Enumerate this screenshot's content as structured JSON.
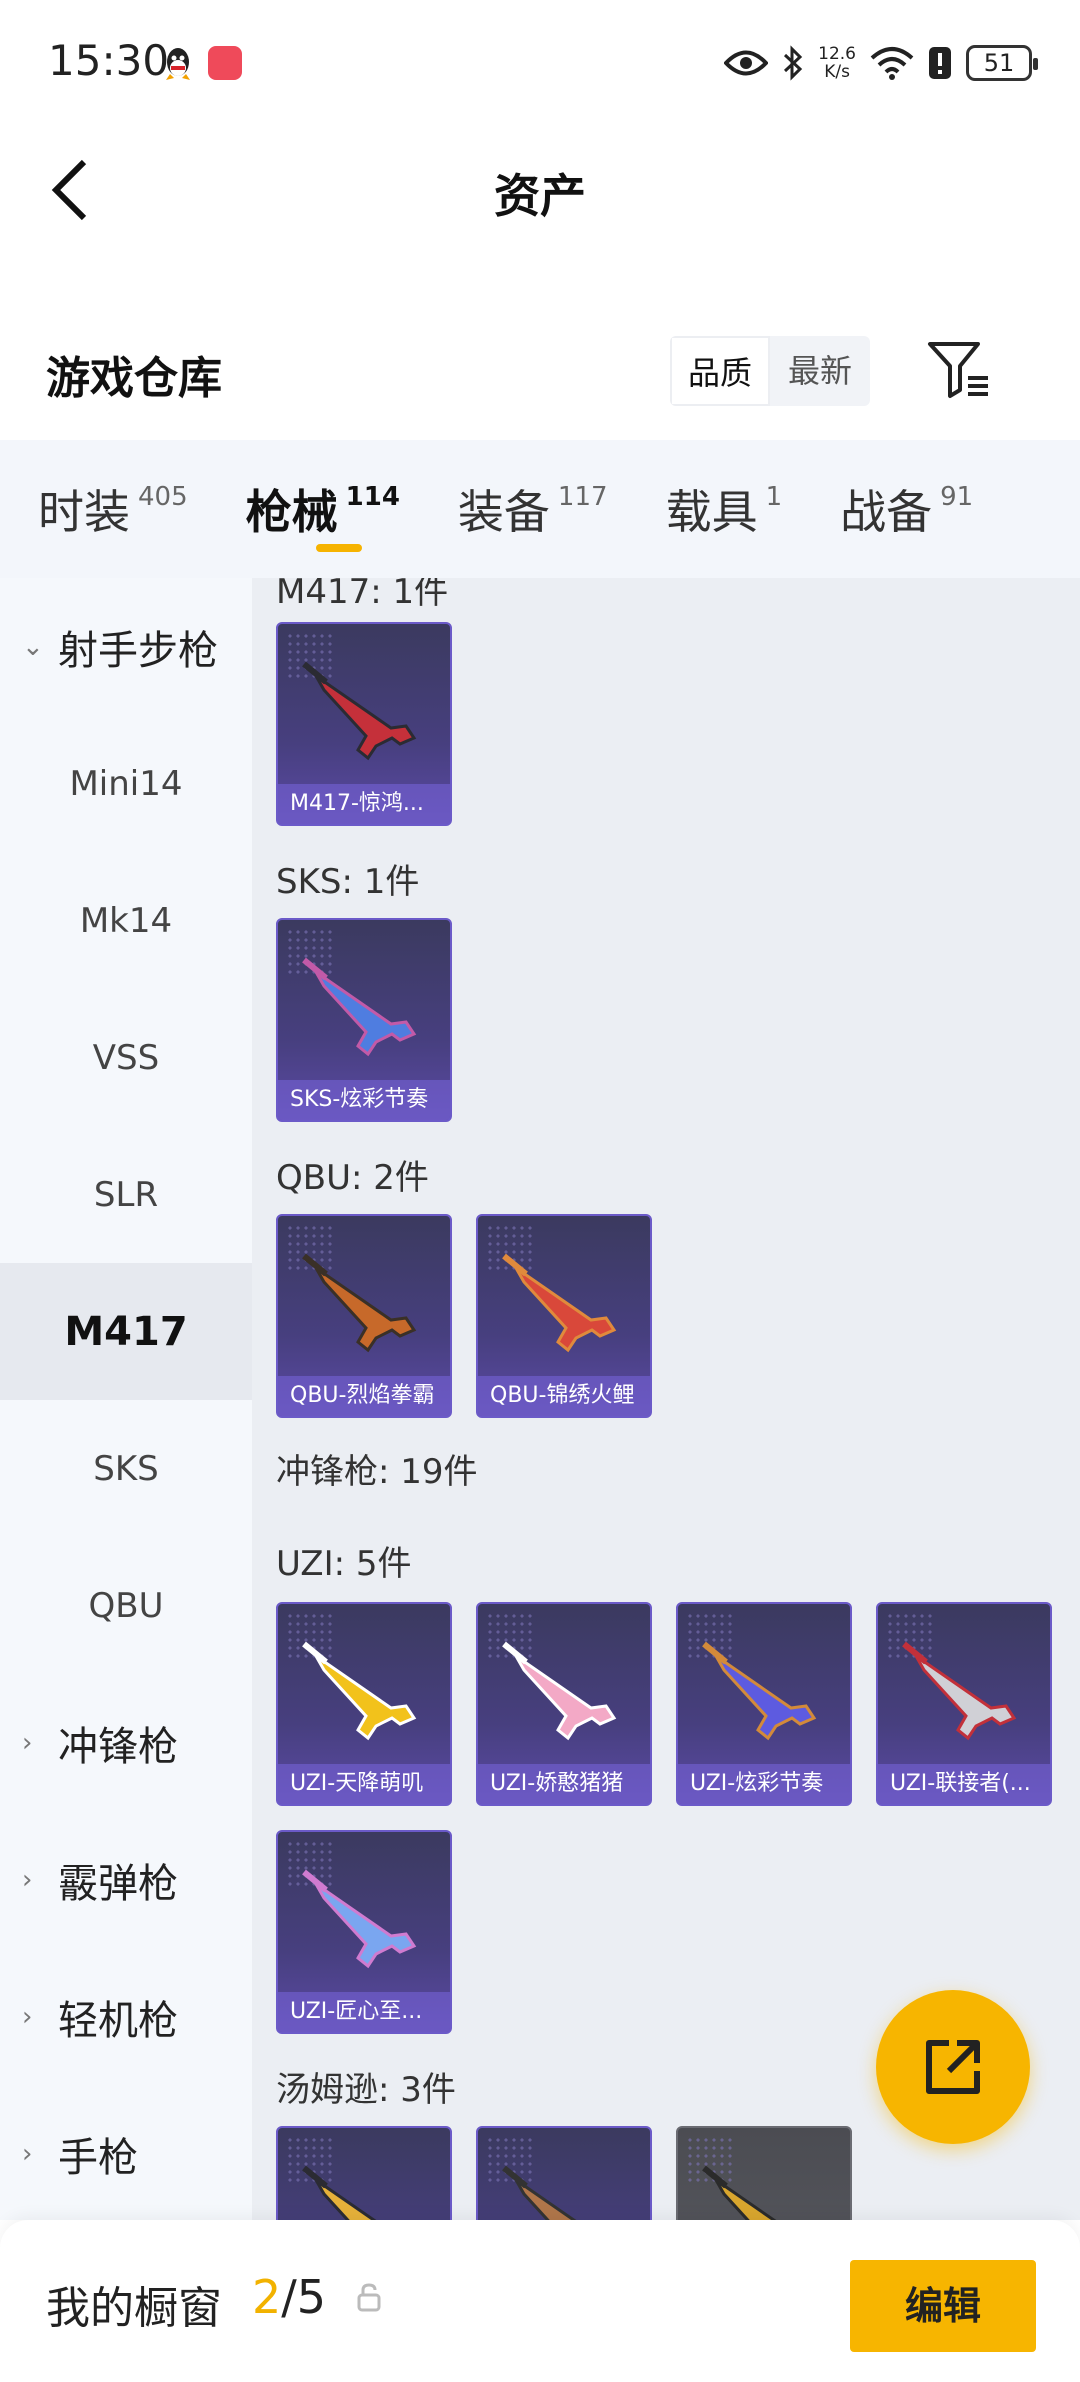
{
  "status_bar": {
    "time": "15:30",
    "net_speed_value": "12.6",
    "net_speed_unit": "K/s",
    "battery": "51",
    "icons": [
      "qq-icon",
      "app-notification-icon",
      "eye-icon",
      "bluetooth-icon",
      "wifi-icon",
      "alert-icon",
      "battery-icon"
    ]
  },
  "header": {
    "title": "资产",
    "back_icon": "chevron-left-icon"
  },
  "warehouse": {
    "title": "游戏仓库",
    "sort_options": [
      "品质",
      "最新"
    ],
    "sort_selected": "品质",
    "filter_icon": "filter-icon"
  },
  "tabs": [
    {
      "label": "时装",
      "count": "405"
    },
    {
      "label": "枪械",
      "count": "114",
      "active": true
    },
    {
      "label": "装备",
      "count": "117"
    },
    {
      "label": "载具",
      "count": "1"
    },
    {
      "label": "战备",
      "count": "91"
    }
  ],
  "sidebar": {
    "items": [
      {
        "label": "射手步枪",
        "type": "group",
        "expanded": true
      },
      {
        "label": "Mini14",
        "type": "sub"
      },
      {
        "label": "Mk14",
        "type": "sub"
      },
      {
        "label": "VSS",
        "type": "sub"
      },
      {
        "label": "SLR",
        "type": "sub"
      },
      {
        "label": "M417",
        "type": "sub",
        "active": true
      },
      {
        "label": "SKS",
        "type": "sub"
      },
      {
        "label": "QBU",
        "type": "sub"
      },
      {
        "label": "冲锋枪",
        "type": "group",
        "expanded": false
      },
      {
        "label": "霰弹枪",
        "type": "group",
        "expanded": false
      },
      {
        "label": "轻机枪",
        "type": "group",
        "expanded": false
      },
      {
        "label": "手枪",
        "type": "group",
        "expanded": false
      }
    ]
  },
  "content": {
    "partial_header": "M417: 1件",
    "groups": [
      {
        "heading": "SKS: 1件"
      },
      {
        "heading": "QBU: 2件"
      },
      {
        "heading": "冲锋枪: 19件"
      },
      {
        "heading": "UZI: 5件"
      },
      {
        "heading": "汤姆逊: 3件"
      }
    ],
    "cards": [
      {
        "name": "M417-惊鸿...",
        "colors": [
          "#c5303a",
          "#2b2b33"
        ]
      },
      {
        "name": "SKS-炫彩节奏",
        "colors": [
          "#4f7de0",
          "#c25aa8"
        ]
      },
      {
        "name": "QBU-烈焰拳霸",
        "colors": [
          "#c7692a",
          "#3a3027"
        ]
      },
      {
        "name": "QBU-锦绣火鲤",
        "colors": [
          "#d9483a",
          "#e08a3c"
        ]
      },
      {
        "name": "UZI-天降萌叽",
        "colors": [
          "#f2c21b",
          "#ffffff"
        ]
      },
      {
        "name": "UZI-娇憨猪猪",
        "colors": [
          "#f3a9c6",
          "#ffffff"
        ]
      },
      {
        "name": "UZI-炫彩节奏",
        "colors": [
          "#5d5be0",
          "#d38a3a"
        ]
      },
      {
        "name": "UZI-联接者(...",
        "colors": [
          "#d0d0d6",
          "#c2303a"
        ]
      },
      {
        "name": "UZI-匠心至...",
        "colors": [
          "#7aa6f0",
          "#d07bd0"
        ]
      },
      {
        "name": "",
        "colors": [
          "#e6b13a",
          "#2b2b33"
        ]
      },
      {
        "name": "",
        "colors": [
          "#b0764a",
          "#333"
        ]
      },
      {
        "name": "",
        "colors": [
          "#d9a62e",
          "#2b2b2b"
        ],
        "grey": true
      }
    ]
  },
  "fab": {
    "icon": "share-external-icon"
  },
  "bottom_bar": {
    "title": "我的橱窗",
    "current": "2",
    "total": "/5",
    "lock_icon": "lock-icon",
    "edit_label": "编辑"
  }
}
